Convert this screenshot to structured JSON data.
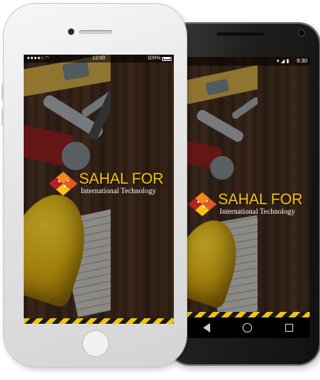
{
  "brand": {
    "name": "SAHAL FOR",
    "tagline": "International Technology",
    "colors": {
      "gold": "#f5c21b",
      "red": "#d3342a",
      "orange": "#f08a1c"
    }
  },
  "ios": {
    "status": {
      "signal": "●●●●○",
      "wifi": "wifi-icon",
      "time": "12:00",
      "battery": "100%"
    }
  },
  "android": {
    "status": {
      "icons": "▾◢▮",
      "time": "9:30"
    },
    "nav": {
      "back": "back-icon",
      "home": "home-icon",
      "recent": "recents-icon"
    }
  }
}
